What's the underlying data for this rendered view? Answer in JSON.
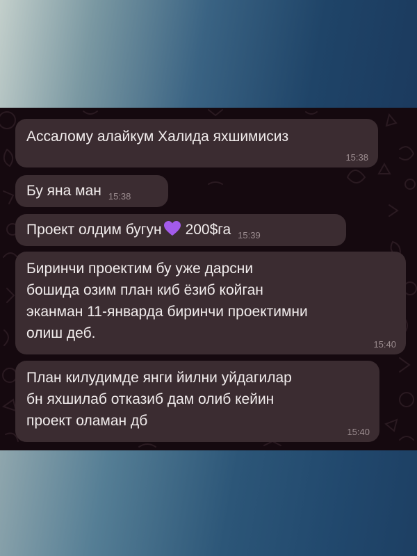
{
  "messages": [
    {
      "text": "Ассалому алайкум Халида яхшимисиз",
      "time": "15:38"
    },
    {
      "text": "Бу яна ман",
      "time": "15:38"
    },
    {
      "text_before": "Проект олдим бугун",
      "emoji": "purple-heart",
      "text_after": "200$га",
      "time": "15:39"
    },
    {
      "lines": [
        "Биринчи проектим бу уже дарсни",
        "бошида озим план киб ёзиб койган",
        "эканман 11-январда биринчи проектимни",
        "олиш деб."
      ],
      "time": "15:40"
    },
    {
      "lines": [
        "План килудимде янги йилни уйдагилар",
        "бн яхшилаб отказиб дам олиб кейин",
        "проект оламан дб"
      ],
      "time": "15:40"
    }
  ],
  "colors": {
    "chat_background": "#15090f",
    "bubble": "#3b2c31",
    "text": "#f1ecec",
    "timestamp": "#9c8d90",
    "heart": "#a35bea"
  }
}
